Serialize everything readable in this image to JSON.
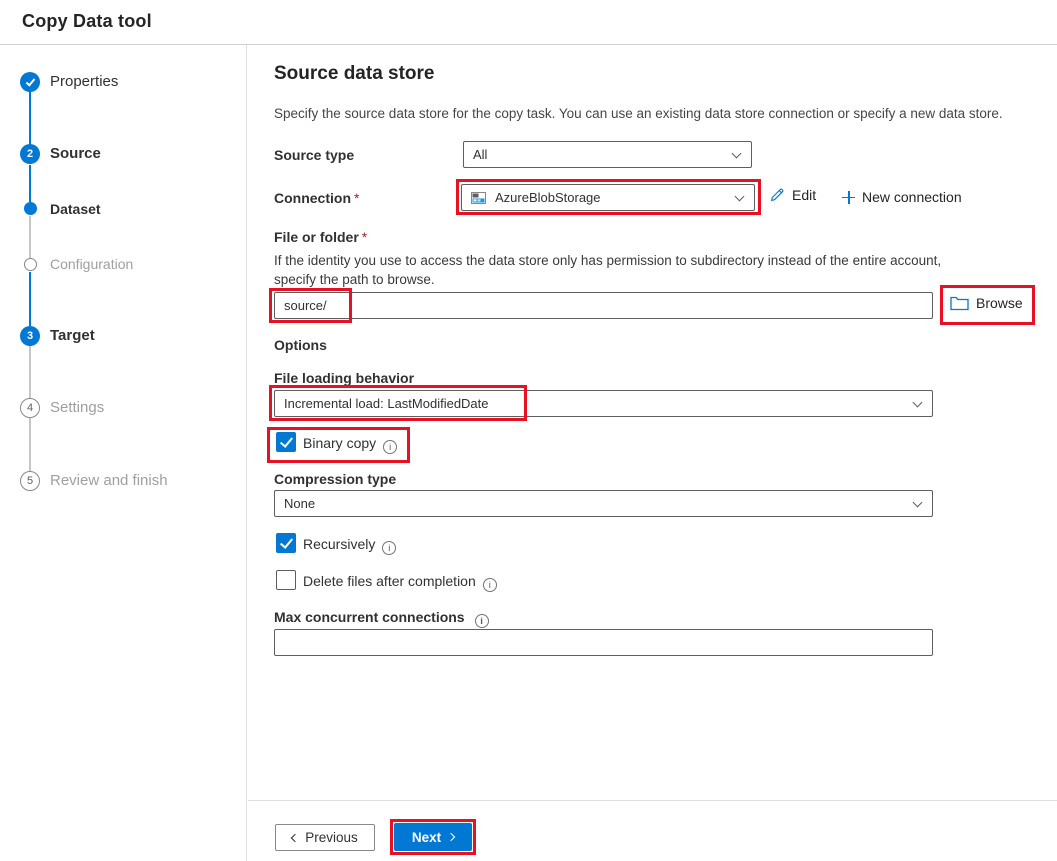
{
  "header": {
    "title": "Copy Data tool"
  },
  "sidebar": {
    "steps": [
      {
        "label": "Properties",
        "marker": "check-icon",
        "state": "completed"
      },
      {
        "label": "Source",
        "marker": "2",
        "state": "active"
      },
      {
        "label": "Dataset",
        "marker": "dot",
        "state": "completed-sub"
      },
      {
        "label": "Configuration",
        "marker": "circle",
        "state": "pending-sub"
      },
      {
        "label": "Target",
        "marker": "3",
        "state": "active"
      },
      {
        "label": "Settings",
        "marker": "4",
        "state": "pending"
      },
      {
        "label": "Review and finish",
        "marker": "5",
        "state": "pending"
      }
    ]
  },
  "main": {
    "title": "Source data store",
    "description": "Specify the source data store for the copy task. You can use an existing data store connection or specify a new data store.",
    "source_type": {
      "label": "Source type",
      "value": "All"
    },
    "connection": {
      "label": "Connection",
      "required": "*",
      "value": "AzureBlobStorage",
      "icon": "azure-blob-storage-icon",
      "edit_label": "Edit",
      "new_connection_label": "New connection"
    },
    "file_or_folder": {
      "label": "File or folder",
      "required": "*",
      "description": "If the identity you use to access the data store only has permission to subdirectory instead of the entire account, specify the path to browse.",
      "value": "source/",
      "browse_label": "Browse"
    },
    "options": {
      "heading": "Options",
      "file_loading_behavior": {
        "label": "File loading behavior",
        "value": "Incremental load: LastModifiedDate"
      },
      "binary_copy": {
        "label": "Binary copy",
        "checked": true
      },
      "compression_type": {
        "label": "Compression type",
        "value": "None"
      },
      "recursively": {
        "label": "Recursively",
        "checked": true
      },
      "delete_files": {
        "label": "Delete files after completion",
        "checked": false
      },
      "max_concurrent": {
        "label": "Max concurrent connections",
        "value": ""
      }
    }
  },
  "footer": {
    "previous_label": "Previous",
    "next_label": "Next"
  },
  "colors": {
    "accent": "#0078d4",
    "annotation_red": "#e81123",
    "required_red": "#a4262c"
  }
}
